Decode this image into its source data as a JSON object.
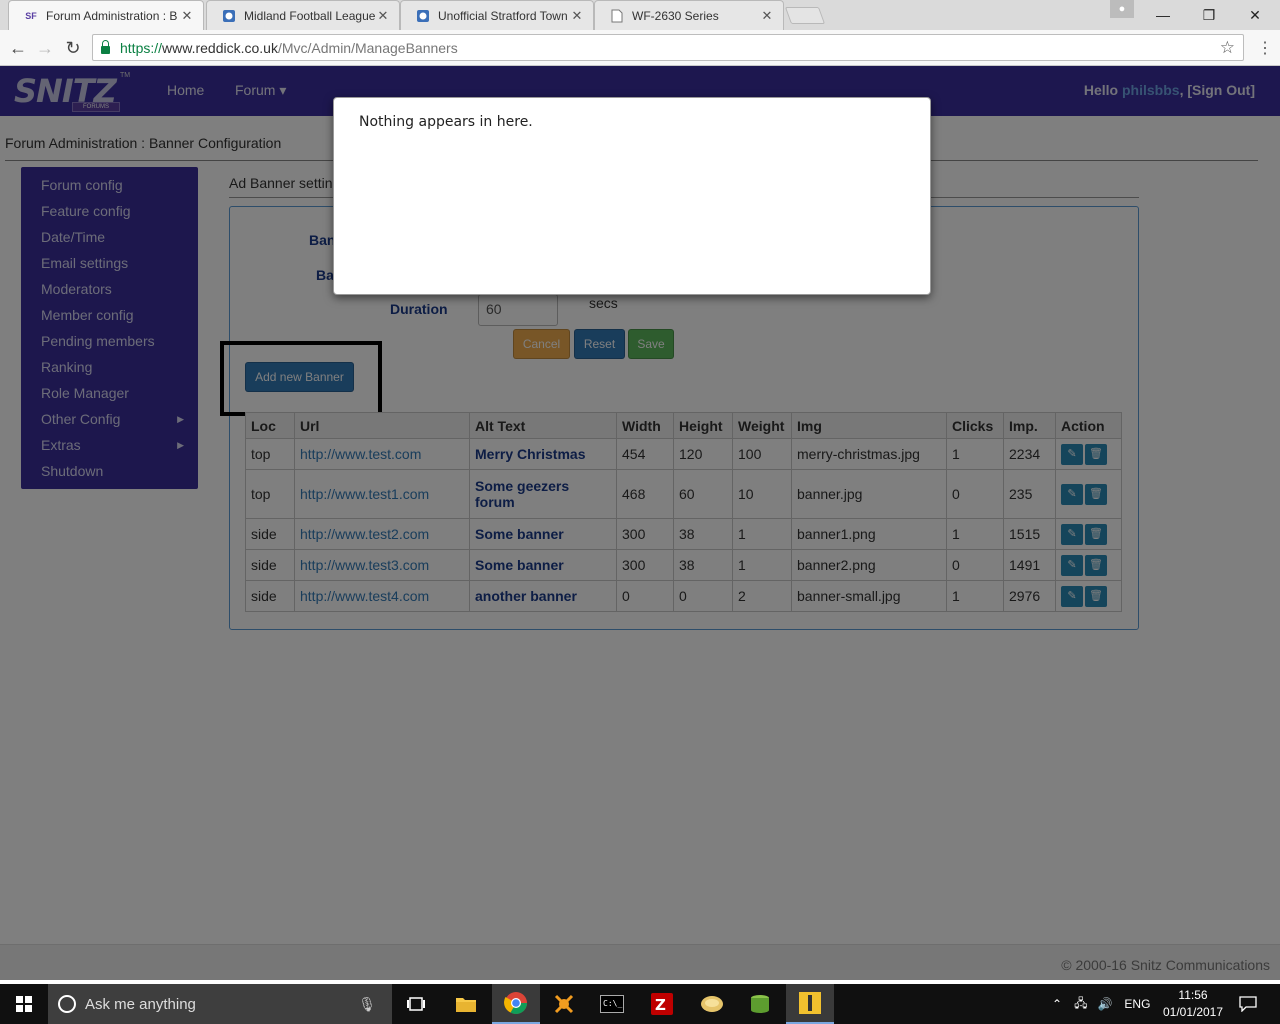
{
  "browser": {
    "tabs": [
      {
        "title": "Forum Administration : B",
        "favicon": "SF",
        "active": true
      },
      {
        "title": "Midland Football League",
        "favicon": "globe",
        "active": false
      },
      {
        "title": "Unofficial Stratford Town",
        "favicon": "globe",
        "active": false
      },
      {
        "title": "WF-2630 Series",
        "favicon": "page",
        "active": false
      }
    ],
    "url_prefix": "https://",
    "url_host": "www.reddick.co.uk",
    "url_path": "/Mvc/Admin/ManageBanners"
  },
  "navbar": {
    "logo": "SNITZ",
    "logo_sub": "FORUMS",
    "logo_tm": "TM",
    "home": "Home",
    "forum": "Forum ▾",
    "hello_prefix": "Hello",
    "username": "philsbbs",
    "signout": ", [Sign Out]"
  },
  "breadcrumb": "Forum Administration : Banner Configuration",
  "sidebar": [
    {
      "label": "Forum config",
      "submenu": false
    },
    {
      "label": "Feature config",
      "submenu": false
    },
    {
      "label": "Date/Time",
      "submenu": false
    },
    {
      "label": "Email settings",
      "submenu": false
    },
    {
      "label": "Moderators",
      "submenu": false
    },
    {
      "label": "Member config",
      "submenu": false
    },
    {
      "label": "Pending members",
      "submenu": false
    },
    {
      "label": "Ranking",
      "submenu": false
    },
    {
      "label": "Role Manager",
      "submenu": false
    },
    {
      "label": "Other Config",
      "submenu": true
    },
    {
      "label": "Extras",
      "submenu": true
    },
    {
      "label": "Shutdown",
      "submenu": false
    }
  ],
  "settings": {
    "title": "Ad Banner settin",
    "label1": "Ban",
    "label2": "Ba",
    "duration_label": "Duration",
    "duration_value": "60",
    "duration_unit": "secs",
    "cancel": "Cancel",
    "reset": "Reset",
    "save": "Save",
    "add_banner": "Add new Banner"
  },
  "table": {
    "headers": [
      "Loc",
      "Url",
      "Alt Text",
      "Width",
      "Height",
      "Weight",
      "Img",
      "Clicks",
      "Imp.",
      "Action"
    ],
    "rows": [
      {
        "loc": "top",
        "url": "http://www.test.com",
        "alt": "Merry Christmas",
        "width": "454",
        "height": "120",
        "weight": "100",
        "img": "merry-christmas.jpg",
        "clicks": "1",
        "imp": "2234"
      },
      {
        "loc": "top",
        "url": "http://www.test1.com",
        "alt": "Some geezers forum",
        "width": "468",
        "height": "60",
        "weight": "10",
        "img": "banner.jpg",
        "clicks": "0",
        "imp": "235"
      },
      {
        "loc": "side",
        "url": "http://www.test2.com",
        "alt": "Some banner",
        "width": "300",
        "height": "38",
        "weight": "1",
        "img": "banner1.png",
        "clicks": "1",
        "imp": "1515"
      },
      {
        "loc": "side",
        "url": "http://www.test3.com",
        "alt": "Some banner",
        "width": "300",
        "height": "38",
        "weight": "1",
        "img": "banner2.png",
        "clicks": "0",
        "imp": "1491"
      },
      {
        "loc": "side",
        "url": "http://www.test4.com",
        "alt": "another banner",
        "width": "0",
        "height": "0",
        "weight": "2",
        "img": "banner-small.jpg",
        "clicks": "1",
        "imp": "2976"
      }
    ]
  },
  "footer": "© 2000-16 Snitz Communications",
  "modal": {
    "text": "Nothing appears in here."
  },
  "taskbar": {
    "search_placeholder": "Ask me anything",
    "language": "ENG",
    "time": "11:56",
    "date": "01/01/2017"
  },
  "colors": {
    "navbar": "#3a2f9f",
    "sidebar": "#3b2e9a",
    "primary": "#337ab7",
    "warning": "#f0ad4e",
    "success": "#5cb85c"
  }
}
